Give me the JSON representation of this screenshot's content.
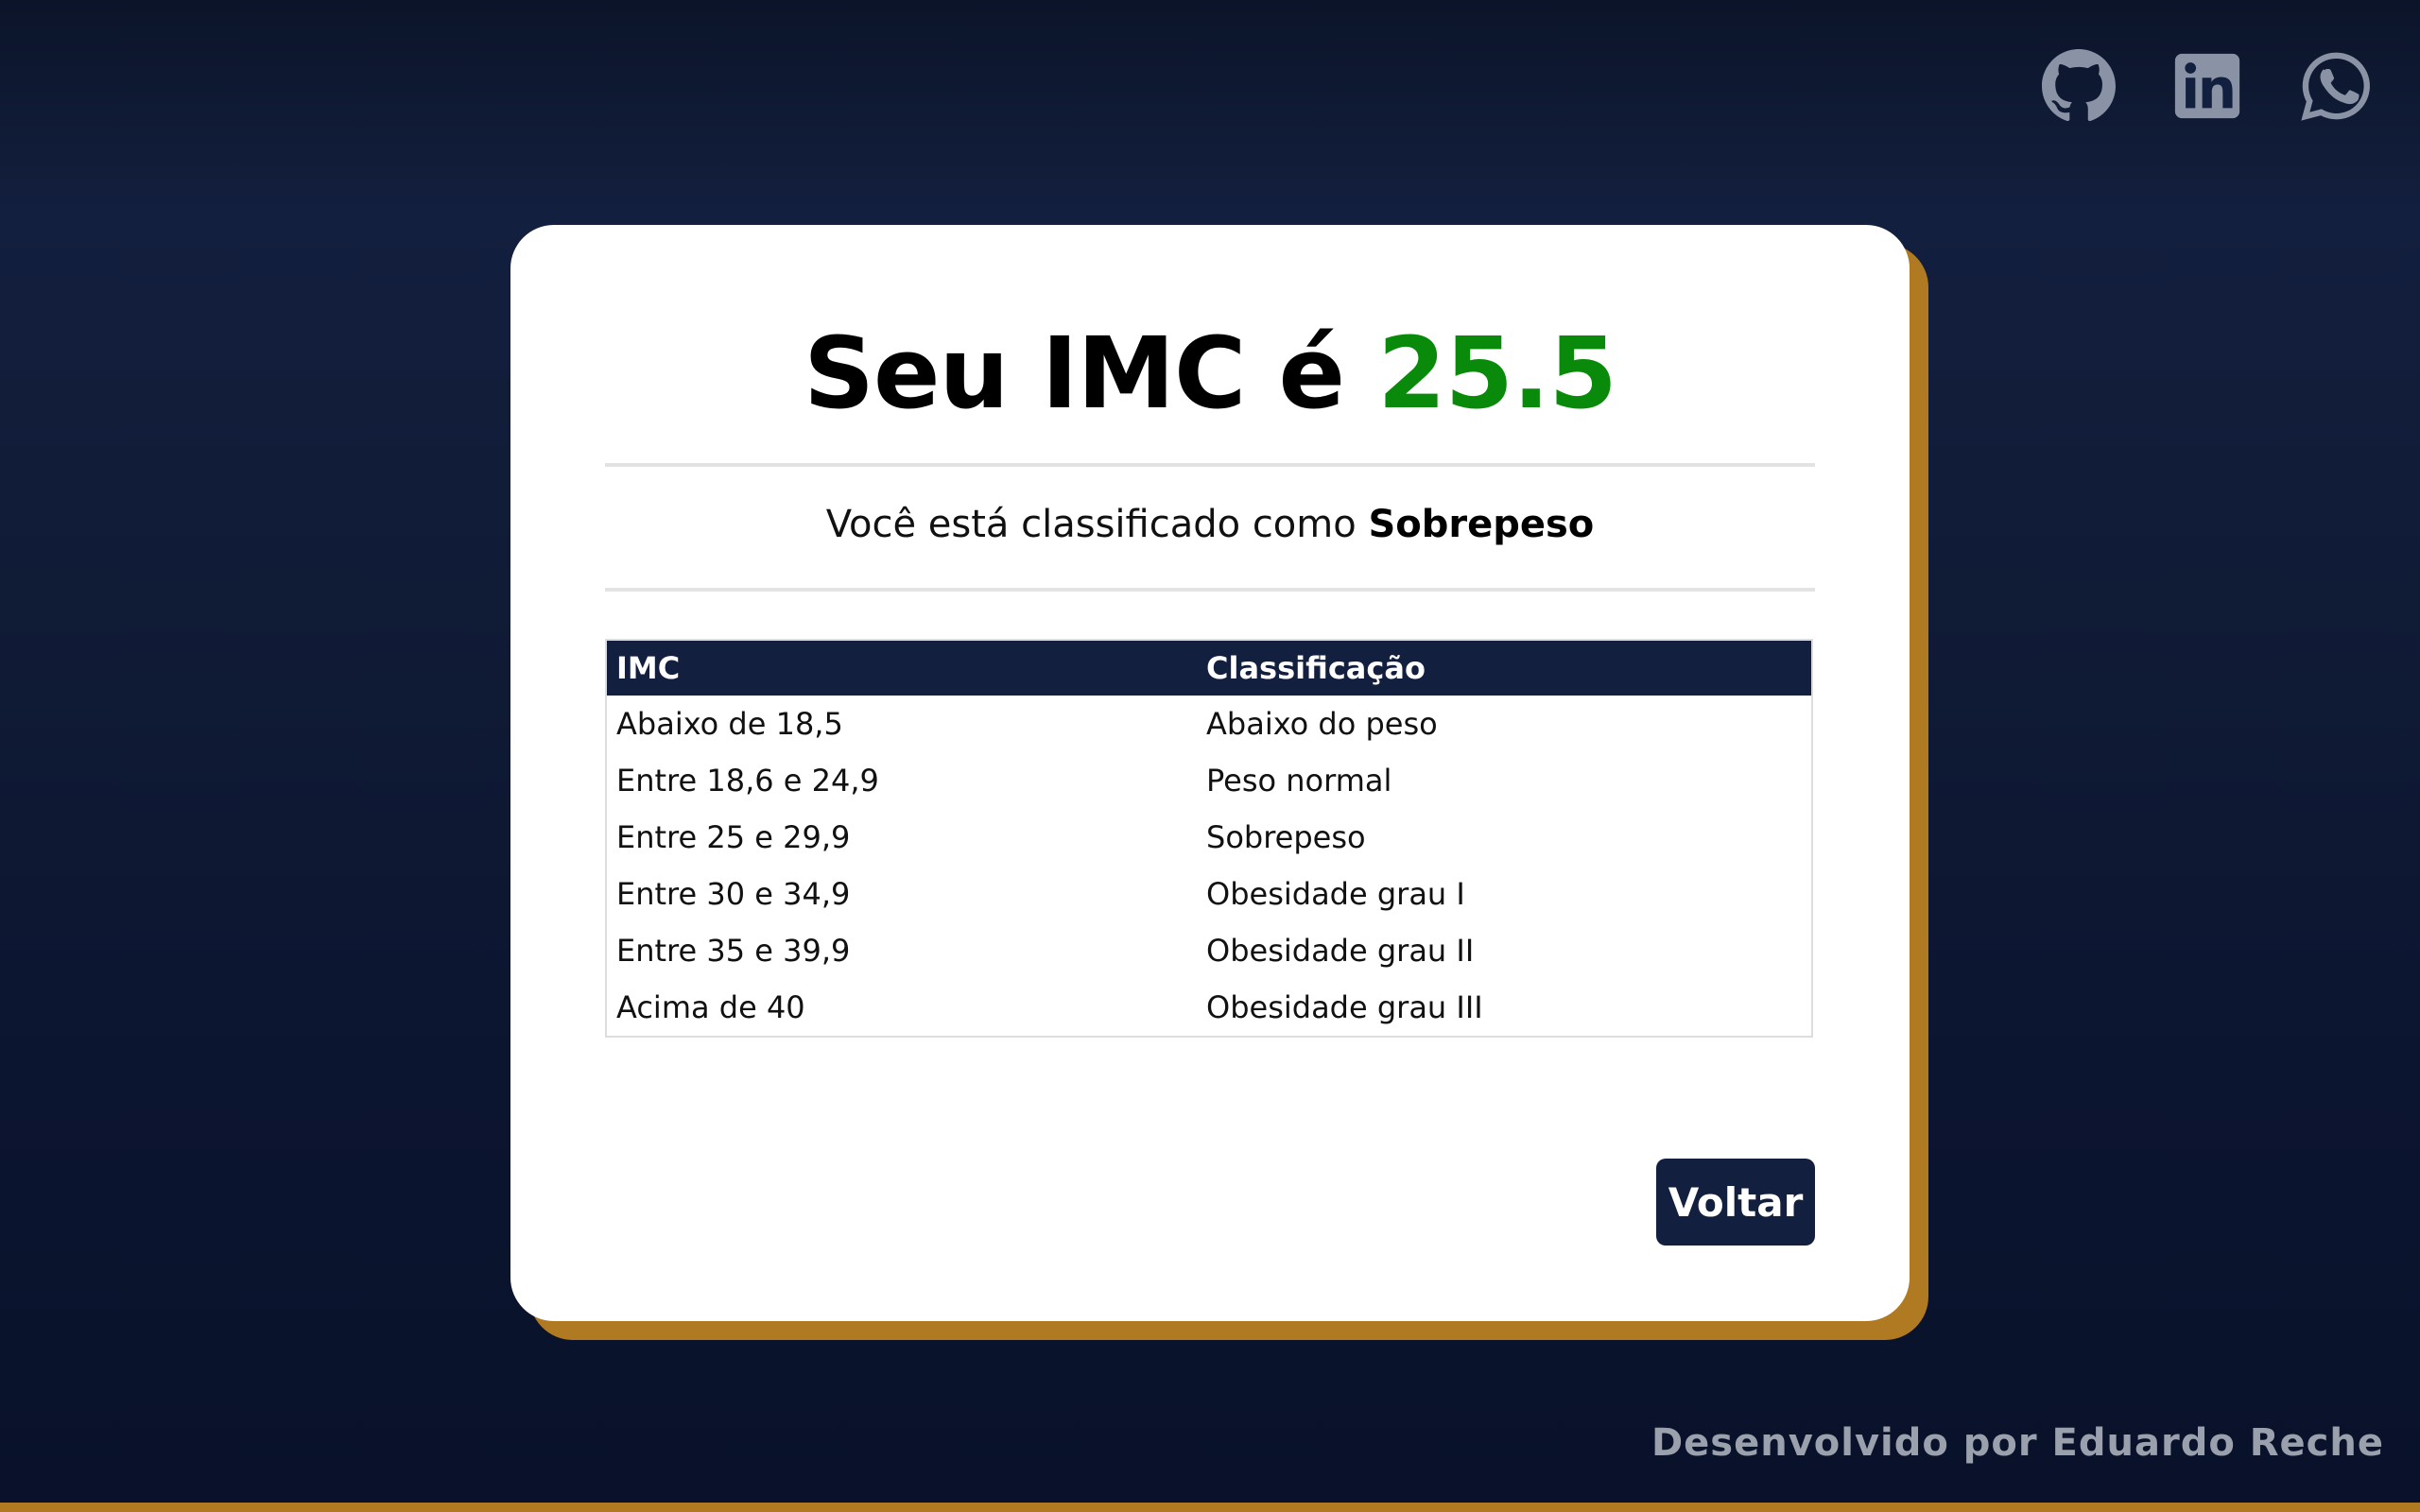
{
  "social": {
    "icons": [
      "github-icon",
      "linkedin-icon",
      "whatsapp-icon"
    ],
    "icon_color": "#8a93a6"
  },
  "result": {
    "title_prefix": "Seu IMC é",
    "imc_value": "25.5",
    "imc_value_color": "#0a8a0a",
    "classification_prefix": "Você está classificado como",
    "classification": "Sobrepeso"
  },
  "table": {
    "headers": [
      "IMC",
      "Classificação"
    ],
    "rows": [
      [
        "Abaixo de 18,5",
        "Abaixo do peso"
      ],
      [
        "Entre 18,6 e 24,9",
        "Peso normal"
      ],
      [
        "Entre 25 e 29,9",
        "Sobrepeso"
      ],
      [
        "Entre 30 e 34,9",
        "Obesidade grau I"
      ],
      [
        "Entre 35 e 39,9",
        "Obesidade grau II"
      ],
      [
        "Acima de 40",
        "Obesidade grau III"
      ]
    ]
  },
  "actions": {
    "back_label": "Voltar"
  },
  "footer": {
    "credit": "Desenvolvido por Eduardo Reche"
  },
  "colors": {
    "navy": "#131f3e",
    "gold_accent": "#b07a22",
    "card": "#ffffff"
  }
}
